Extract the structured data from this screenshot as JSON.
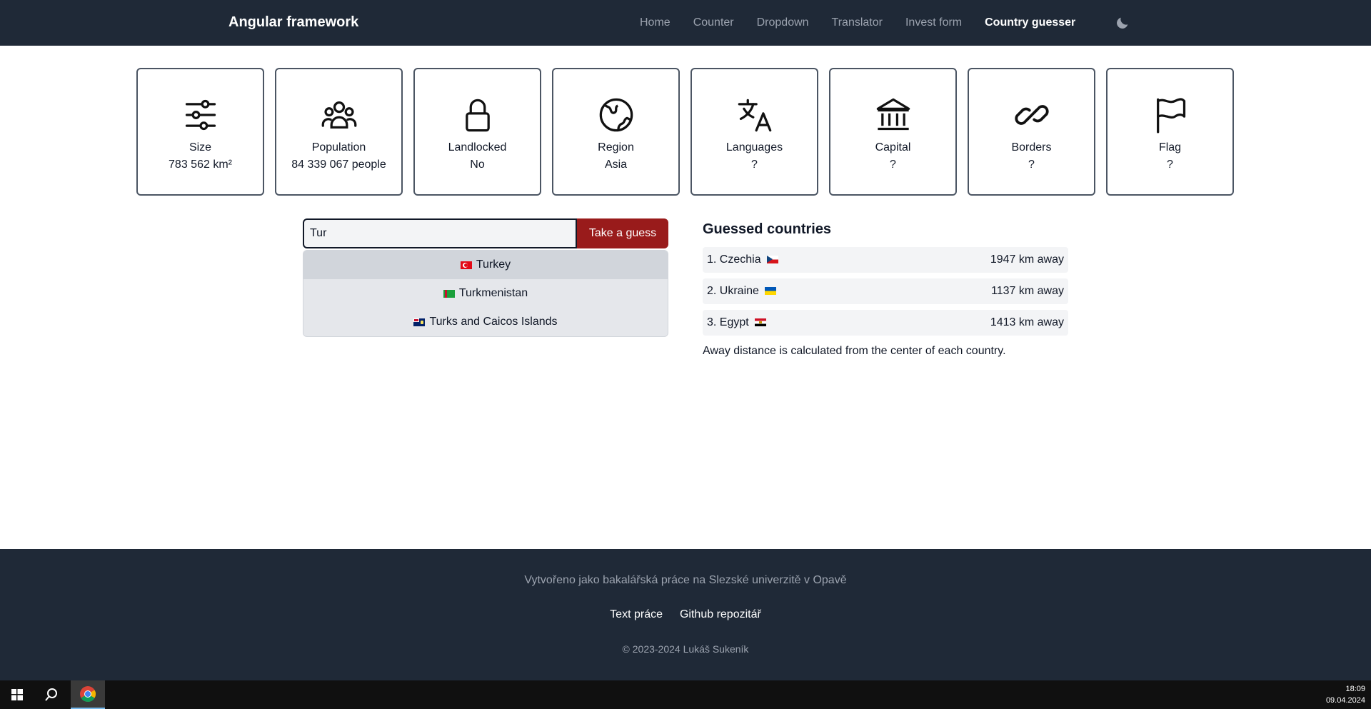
{
  "navbar": {
    "brand": "Angular framework",
    "links": [
      "Home",
      "Counter",
      "Dropdown",
      "Translator",
      "Invest form",
      "Country guesser"
    ],
    "active_index": 5,
    "theme_icon": "moon-icon"
  },
  "cards": [
    {
      "icon": "sliders-icon",
      "label": "Size",
      "value": "783 562 km²"
    },
    {
      "icon": "people-icon",
      "label": "Population",
      "value": "84 339 067 people"
    },
    {
      "icon": "lock-icon",
      "label": "Landlocked",
      "value": "No"
    },
    {
      "icon": "globe-icon",
      "label": "Region",
      "value": "Asia"
    },
    {
      "icon": "translate-icon",
      "label": "Languages",
      "value": "?"
    },
    {
      "icon": "bank-icon",
      "label": "Capital",
      "value": "?"
    },
    {
      "icon": "link-icon",
      "label": "Borders",
      "value": "?"
    },
    {
      "icon": "flag-icon",
      "label": "Flag",
      "value": "?"
    }
  ],
  "guess": {
    "input_value": "Tur",
    "button_label": "Take a guess",
    "suggestions": [
      "Turkey",
      "Turkmenistan",
      "Turks and Caicos Islands"
    ],
    "highlighted_index": 0
  },
  "guessed": {
    "title": "Guessed countries",
    "items": [
      {
        "name": "1. Czechia",
        "distance": "1947 km away"
      },
      {
        "name": "2. Ukraine",
        "distance": "1137 km away"
      },
      {
        "name": "3. Egypt",
        "distance": "1413 km away"
      }
    ],
    "note": "Away distance is calculated from the center of each country."
  },
  "footer": {
    "credit": "Vytvořeno jako bakalářská práce na Slezské univerzitě v Opavě",
    "links": [
      "Text práce",
      "Github repozitář"
    ],
    "copyright": "© 2023-2024 Lukáš Sukeník"
  },
  "taskbar": {
    "time": "18:09",
    "date": "09.04.2024"
  },
  "colors": {
    "navbar_bg": "#1f2937",
    "accent_button": "#991b1b",
    "card_border": "#4b5563"
  }
}
